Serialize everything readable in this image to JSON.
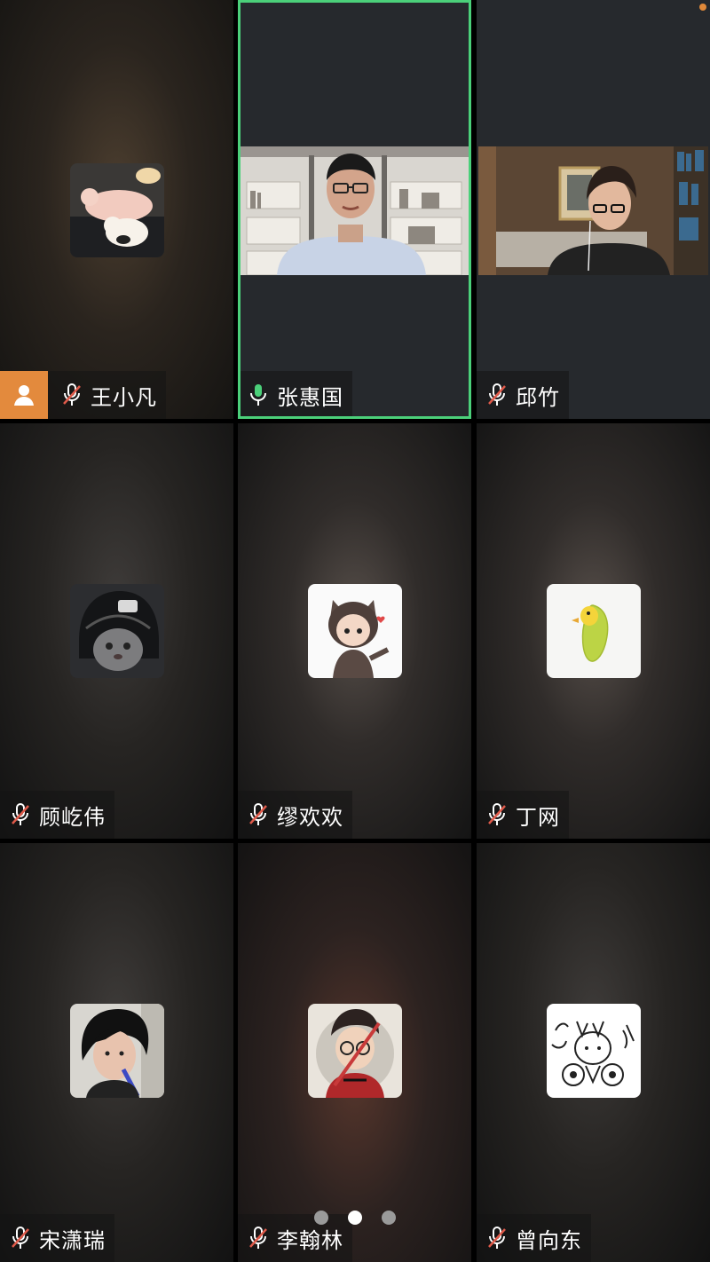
{
  "participants": [
    {
      "name": "王小凡",
      "mic": "muted",
      "view": "avatar",
      "has_user_badge": true
    },
    {
      "name": "张惠国",
      "mic": "active",
      "view": "video",
      "speaking": true
    },
    {
      "name": "邱竹",
      "mic": "muted",
      "view": "video"
    },
    {
      "name": "顾屹伟",
      "mic": "muted",
      "view": "avatar"
    },
    {
      "name": "缪欢欢",
      "mic": "muted",
      "view": "avatar"
    },
    {
      "name": "丁网",
      "mic": "muted",
      "view": "avatar"
    },
    {
      "name": "宋潇瑞",
      "mic": "muted",
      "view": "avatar"
    },
    {
      "name": "李翰林",
      "mic": "muted",
      "view": "avatar"
    },
    {
      "name": "曾向东",
      "mic": "muted",
      "view": "avatar"
    }
  ],
  "pager": {
    "pages": 3,
    "current": 2
  },
  "colors": {
    "speaking_outline": "#4bd07a",
    "mic_active": "#4bd07a",
    "mic_muted_slash": "#e05a4a",
    "user_badge": "#e38a3d"
  },
  "icons": {
    "mic_muted": "mic-muted-icon",
    "mic_active": "mic-icon",
    "user_badge": "user-icon"
  }
}
